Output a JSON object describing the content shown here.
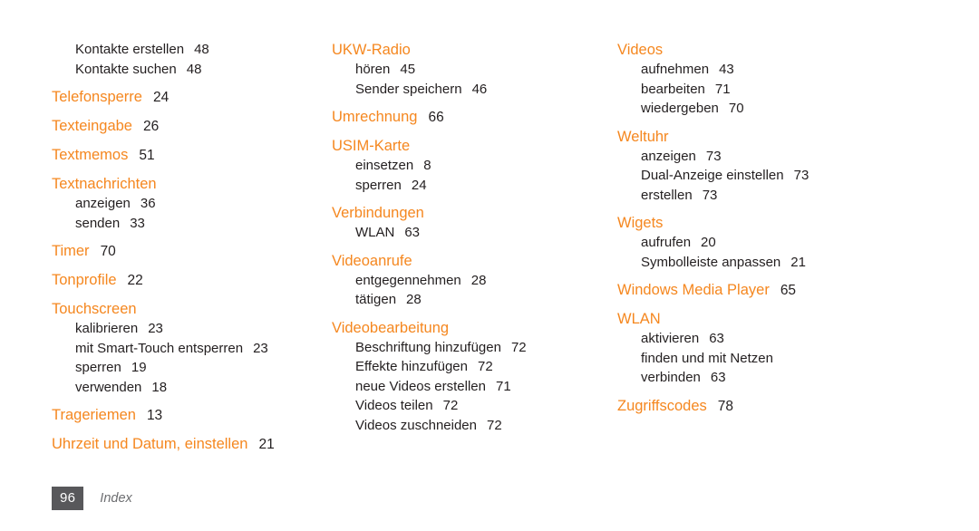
{
  "document": {
    "type": "index-page",
    "language": "de",
    "background_color": "#ffffff",
    "heading_color": "#f5871f",
    "body_color": "#231f20"
  },
  "footer": {
    "page_number": "96",
    "section_label": "Index",
    "folio_box_color": "#58585b",
    "folio_text_color": "#ffffff",
    "label_color": "#6d6e71"
  },
  "columns": [
    {
      "id": "column-1",
      "entries": [
        {
          "kind": "sub",
          "label": "Kontakte erstellen",
          "page": "48"
        },
        {
          "kind": "sub",
          "label": "Kontakte suchen",
          "page": "48"
        },
        {
          "kind": "head",
          "label": "Telefonsperre",
          "page": "24"
        },
        {
          "kind": "head",
          "label": "Texteingabe",
          "page": "26"
        },
        {
          "kind": "head",
          "label": "Textmemos",
          "page": "51"
        },
        {
          "kind": "head",
          "label": "Textnachrichten",
          "page": ""
        },
        {
          "kind": "sub",
          "label": "anzeigen",
          "page": "36"
        },
        {
          "kind": "sub",
          "label": "senden",
          "page": "33"
        },
        {
          "kind": "head",
          "label": "Timer",
          "page": "70"
        },
        {
          "kind": "head",
          "label": "Tonprofile",
          "page": "22"
        },
        {
          "kind": "head",
          "label": "Touchscreen",
          "page": ""
        },
        {
          "kind": "sub",
          "label": "kalibrieren",
          "page": "23"
        },
        {
          "kind": "sub",
          "label": "mit Smart-Touch entsperren",
          "page": "23"
        },
        {
          "kind": "sub",
          "label": "sperren",
          "page": "19"
        },
        {
          "kind": "sub",
          "label": "verwenden",
          "page": "18"
        },
        {
          "kind": "head",
          "label": "Trageriemen",
          "page": "13"
        },
        {
          "kind": "head",
          "label": "Uhrzeit und Datum, einstellen",
          "page": "21"
        }
      ]
    },
    {
      "id": "column-2",
      "entries": [
        {
          "kind": "head",
          "label": "UKW-Radio",
          "page": ""
        },
        {
          "kind": "sub",
          "label": "hören",
          "page": "45"
        },
        {
          "kind": "sub",
          "label": "Sender speichern",
          "page": "46"
        },
        {
          "kind": "head",
          "label": "Umrechnung",
          "page": "66"
        },
        {
          "kind": "head",
          "label": "USIM-Karte",
          "page": ""
        },
        {
          "kind": "sub",
          "label": "einsetzen",
          "page": "8"
        },
        {
          "kind": "sub",
          "label": "sperren",
          "page": "24"
        },
        {
          "kind": "head",
          "label": "Verbindungen",
          "page": ""
        },
        {
          "kind": "sub",
          "label": "WLAN",
          "page": "63"
        },
        {
          "kind": "head",
          "label": "Videoanrufe",
          "page": ""
        },
        {
          "kind": "sub",
          "label": "entgegennehmen",
          "page": "28"
        },
        {
          "kind": "sub",
          "label": "tätigen",
          "page": "28"
        },
        {
          "kind": "head",
          "label": "Videobearbeitung",
          "page": ""
        },
        {
          "kind": "sub",
          "label": "Beschriftung hinzufügen",
          "page": "72"
        },
        {
          "kind": "sub",
          "label": "Effekte hinzufügen",
          "page": "72"
        },
        {
          "kind": "sub",
          "label": "neue Videos erstellen",
          "page": "71"
        },
        {
          "kind": "sub",
          "label": "Videos teilen",
          "page": "72"
        },
        {
          "kind": "sub",
          "label": "Videos zuschneiden",
          "page": "72"
        }
      ]
    },
    {
      "id": "column-3",
      "entries": [
        {
          "kind": "head",
          "label": "Videos",
          "page": ""
        },
        {
          "kind": "sub",
          "label": "aufnehmen",
          "page": "43"
        },
        {
          "kind": "sub",
          "label": "bearbeiten",
          "page": "71"
        },
        {
          "kind": "sub",
          "label": "wiedergeben",
          "page": "70"
        },
        {
          "kind": "head",
          "label": "Weltuhr",
          "page": ""
        },
        {
          "kind": "sub",
          "label": "anzeigen",
          "page": "73"
        },
        {
          "kind": "sub",
          "label": "Dual-Anzeige einstellen",
          "page": "73"
        },
        {
          "kind": "sub",
          "label": "erstellen",
          "page": "73"
        },
        {
          "kind": "head",
          "label": "Wigets",
          "page": ""
        },
        {
          "kind": "sub",
          "label": "aufrufen",
          "page": "20"
        },
        {
          "kind": "sub",
          "label": "Symbolleiste anpassen",
          "page": "21"
        },
        {
          "kind": "head",
          "label": "Windows Media Player",
          "page": "65"
        },
        {
          "kind": "head",
          "label": "WLAN",
          "page": ""
        },
        {
          "kind": "sub",
          "label": "aktivieren",
          "page": "63"
        },
        {
          "kind": "sub",
          "label": "finden und mit Netzen",
          "page": ""
        },
        {
          "kind": "sub",
          "label": "verbinden",
          "page": "63"
        },
        {
          "kind": "head",
          "label": "Zugriffscodes",
          "page": "78"
        }
      ]
    }
  ]
}
